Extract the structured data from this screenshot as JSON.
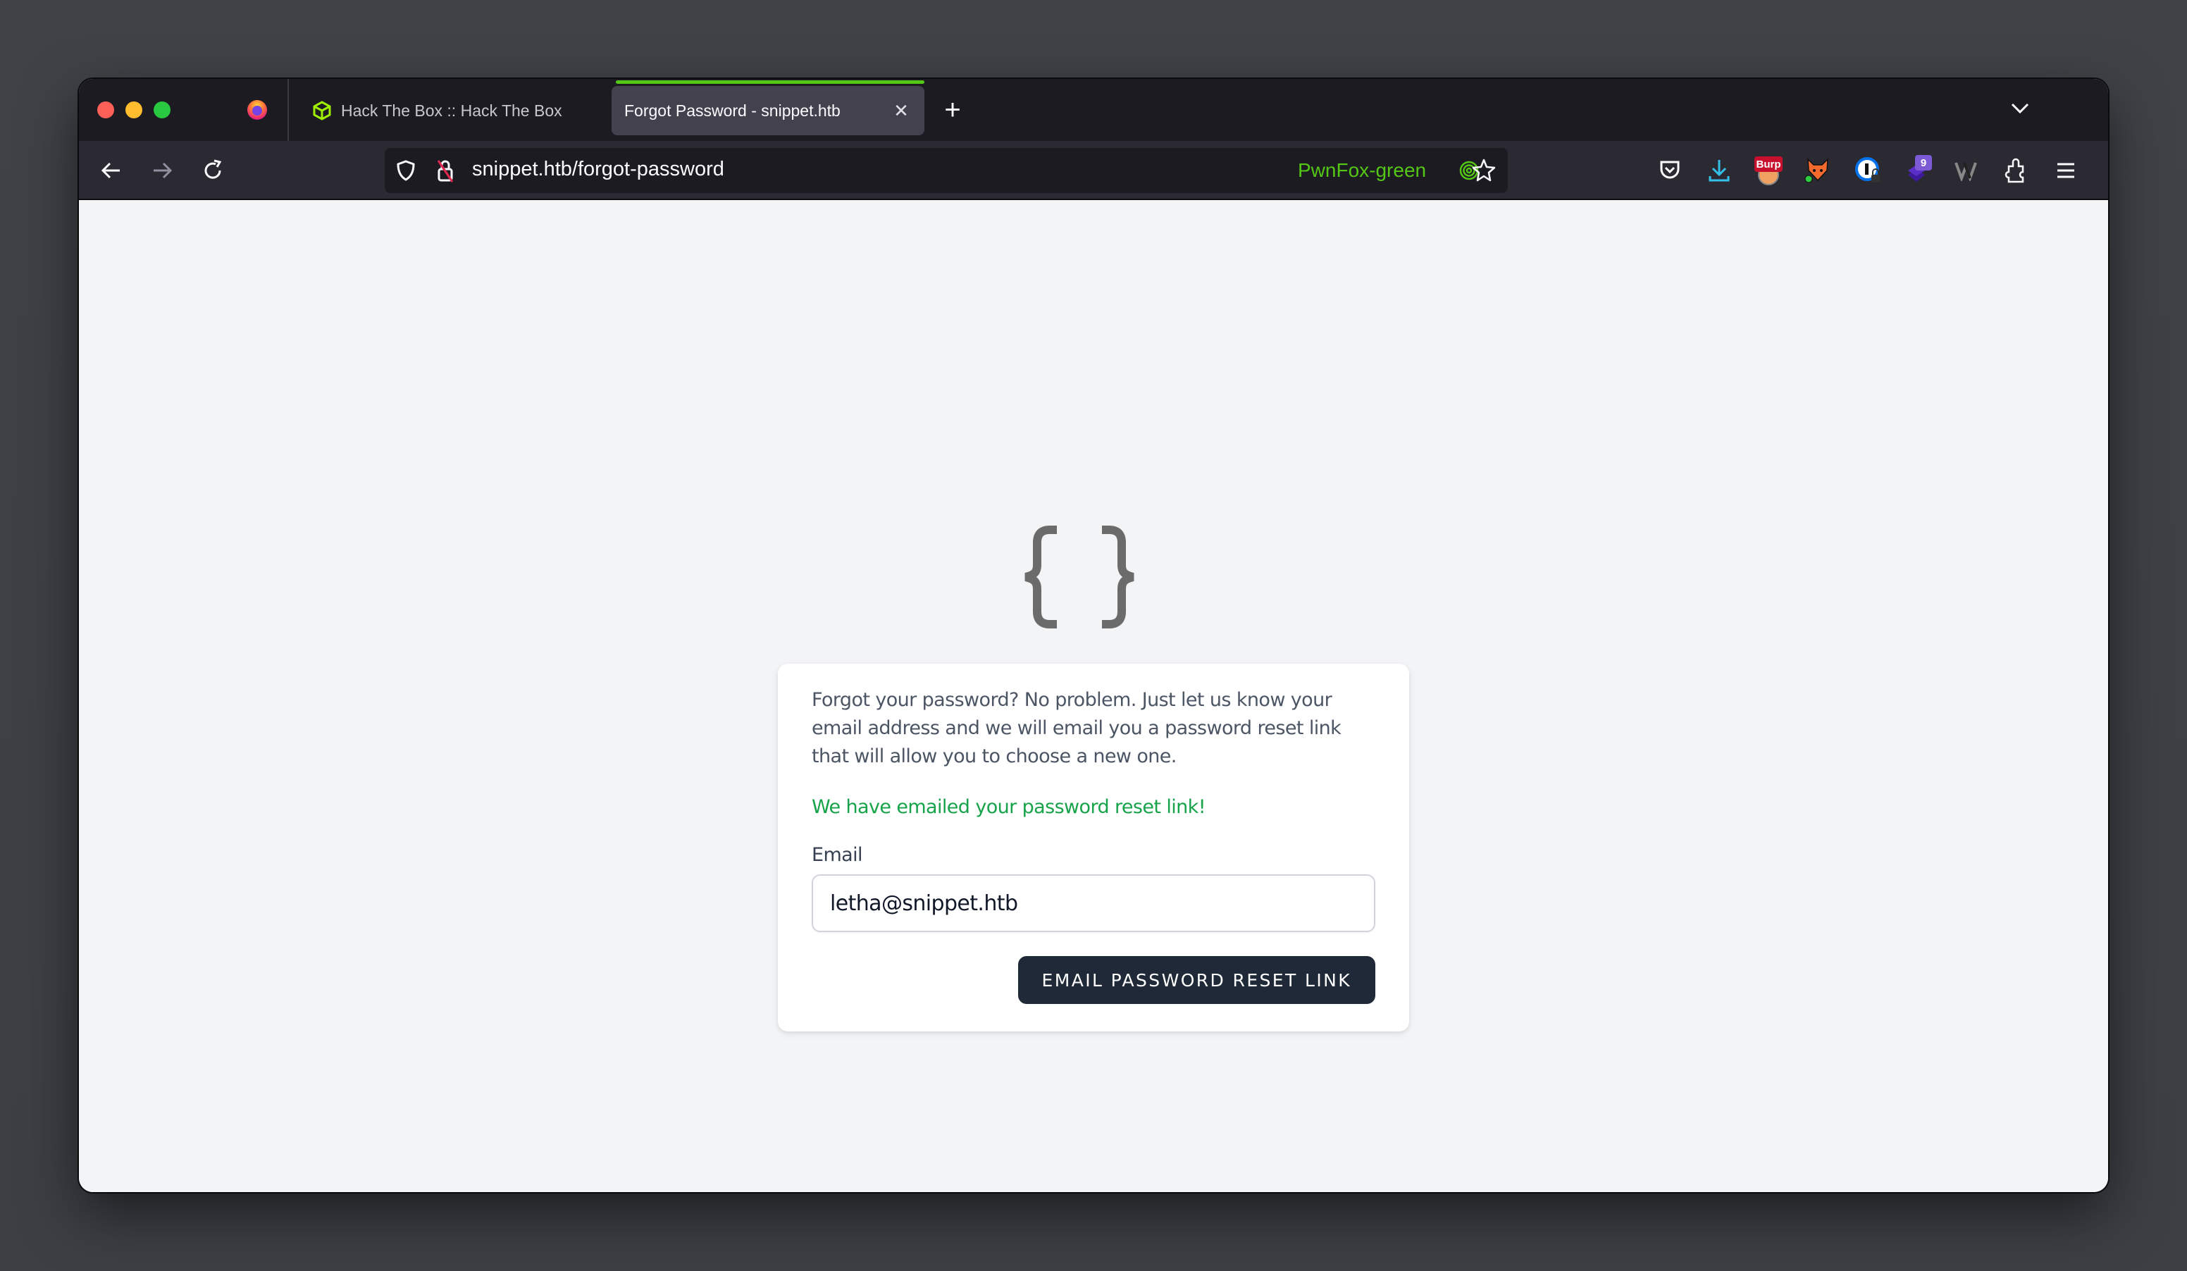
{
  "browser": {
    "tabs": [
      {
        "title": "Hack The Box :: Hack The Box",
        "icon": "htb-cube-icon",
        "active": false
      },
      {
        "title": "Forgot Password - snippet.htb",
        "icon": "none",
        "active": true
      }
    ],
    "close_glyph": "✕",
    "new_tab_glyph": "+",
    "url": "snippet.htb/forgot-password",
    "container_label": "PwnFox-green",
    "colors": {
      "container": "#54c716",
      "active_tab_line": "#54c716",
      "download": "#34c1e8"
    },
    "extensions": [
      {
        "name": "pocket"
      },
      {
        "name": "downloads"
      },
      {
        "name": "burp",
        "badge": "Burp"
      },
      {
        "name": "pwnfox"
      },
      {
        "name": "password-manager"
      },
      {
        "name": "layers",
        "badge": "9"
      },
      {
        "name": "wappalyzer"
      },
      {
        "name": "extensions"
      },
      {
        "name": "menu"
      }
    ]
  },
  "page": {
    "logo": "{ }",
    "description": "Forgot your password? No problem. Just let us know your email address and we will email you a password reset link that will allow you to choose a new one.",
    "status": "We have emailed your password reset link!",
    "email_label": "Email",
    "email_value": "letha@snippet.htb",
    "submit_label": "Email Password Reset Link",
    "colors": {
      "status": "#16a34a",
      "button": "#1f2937"
    }
  }
}
